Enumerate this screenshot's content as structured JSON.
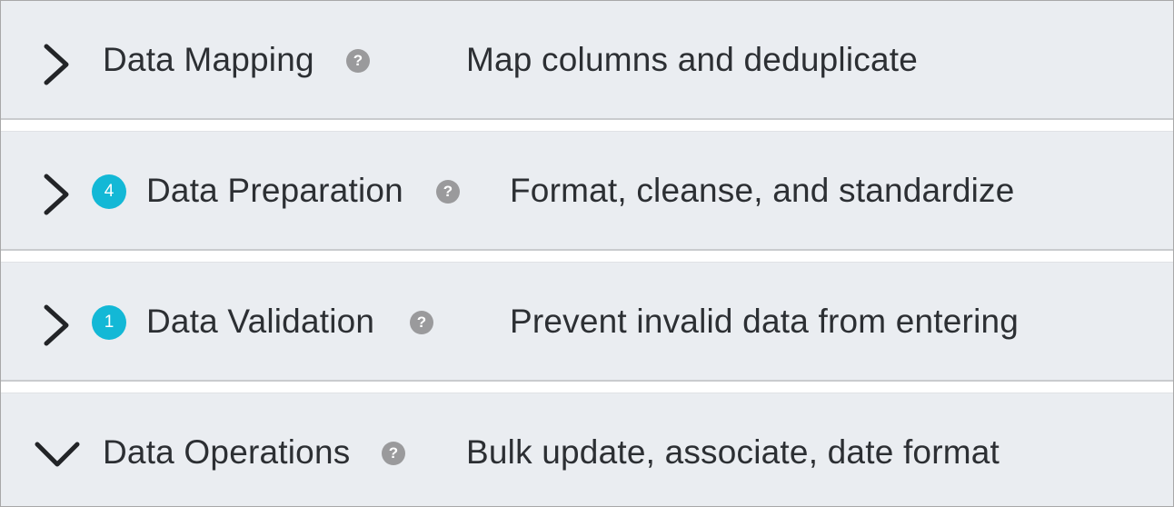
{
  "sections": [
    {
      "title": "Data Mapping",
      "description": "Map columns and deduplicate",
      "badge": null,
      "expanded": false,
      "help_icon_text": "?"
    },
    {
      "title": "Data Preparation",
      "description": "Format, cleanse, and standardize",
      "badge": "4",
      "expanded": false,
      "help_icon_text": "?"
    },
    {
      "title": "Data Validation",
      "description": "Prevent invalid data from entering",
      "badge": "1",
      "expanded": false,
      "help_icon_text": "?"
    },
    {
      "title": "Data Operations",
      "description": "Bulk update, associate, date format",
      "badge": null,
      "expanded": true,
      "help_icon_text": "?"
    }
  ],
  "colors": {
    "row_background": "#eaedf1",
    "badge": "#13b8d6",
    "help_icon": "#9a9a9c",
    "text": "#2c2f33"
  }
}
